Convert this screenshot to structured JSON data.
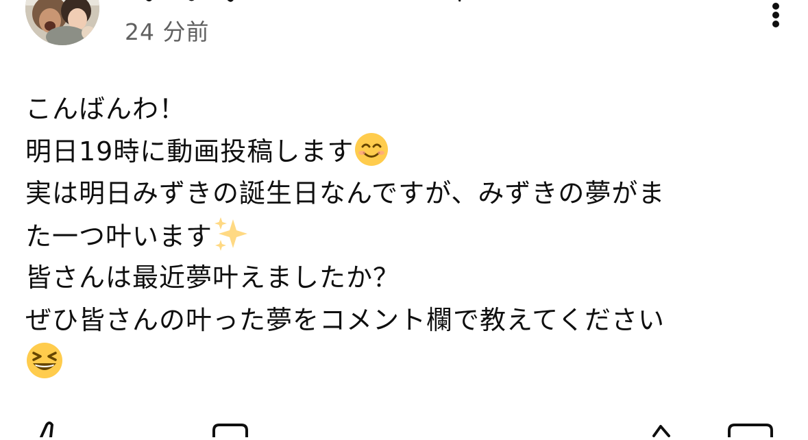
{
  "post": {
    "timestamp": "24 分前",
    "lines": [
      "こんばんわ！",
      "明日19時に動画投稿します",
      "実は明日みずきの誕生日なんですが、みずきの夢がま",
      "た一つ叶います",
      "皆さんは最近夢叶えましたか？",
      "ぜひ皆さんの叶った夢をコメント欄で教えてください",
      ""
    ],
    "emoji": {
      "line2": "smiling-face-emoji",
      "line4": "sparkles-emoji",
      "line7": "grinning-squinting-face-emoji"
    }
  },
  "icons": {
    "more": "more-vert-icon",
    "like": "thumbs-up-icon",
    "comment": "comment-icon",
    "share": "share-icon",
    "extra": "square-icon"
  },
  "colors": {
    "text": "#0f0f0f",
    "secondary_text": "#606060",
    "background": "#ffffff",
    "emoji_yellow": "#ffcc4d",
    "sparkle_yellow": "#ffd983"
  }
}
